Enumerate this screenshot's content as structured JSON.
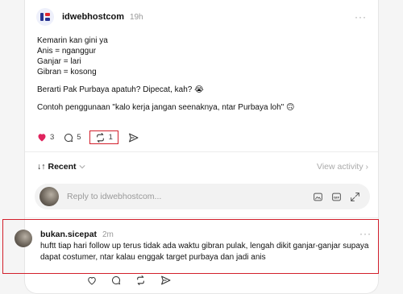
{
  "post": {
    "username": "idwebhostcom",
    "time": "19h",
    "more": "···",
    "lines": [
      "Kemarin kan gini ya",
      "Anis = nganggur",
      "Ganjar = lari",
      "Gibran = kosong"
    ],
    "line2": "Berarti Pak Purbaya apatuh? Dipecat, kah? 😭",
    "line3": "Contoh penggunaan \"kalo kerja jangan seenaknya, ntar Purbaya loh\" 🙃",
    "likes": "3",
    "replies": "5",
    "reposts": "1"
  },
  "sort": {
    "label": "Recent",
    "arrow": "↓↑"
  },
  "view_activity": "View activity ›",
  "reply": {
    "placeholder": "Reply to idwebhostcom..."
  },
  "comment": {
    "username": "bukan.sicepat",
    "time": "2m",
    "more": "···",
    "text": "huftt tiap hari follow up terus tidak ada waktu gibran pulak, lengah dikit ganjar-ganjar supaya dapat costumer, ntar kalau enggak target purbaya dan jadi anis"
  },
  "colors": {
    "like": "#e0245e",
    "highlight": "#d21f2b"
  }
}
